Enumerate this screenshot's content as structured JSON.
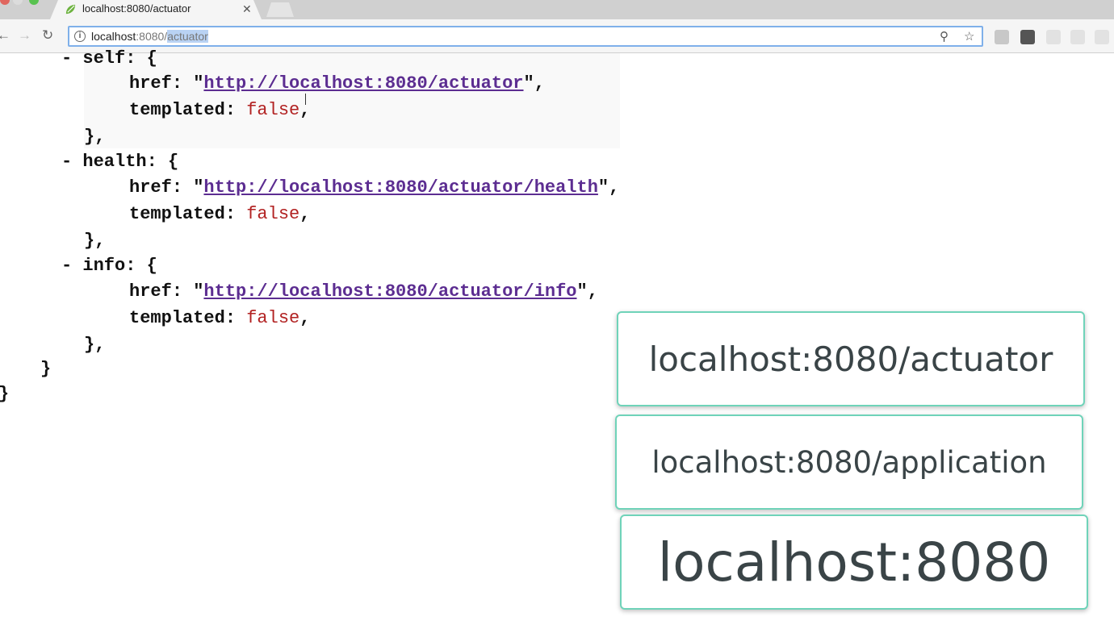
{
  "browser": {
    "tab_title": "localhost:8080/actuator",
    "tab_close": "✕",
    "nav_back": "←",
    "nav_forward": "→",
    "nav_reload": "↻",
    "info_glyph": "i",
    "url_host": "localhost",
    "url_port": ":8080/",
    "url_path": "actuator",
    "zoom_glyph": "⚲",
    "star_glyph": "☆"
  },
  "json": {
    "links": [
      {
        "key": "self",
        "href": "http://localhost:8080/actuator",
        "templated": "false"
      },
      {
        "key": "health",
        "href": "http://localhost:8080/actuator/health",
        "templated": "false"
      },
      {
        "key": "info",
        "href": "http://localhost:8080/actuator/info",
        "templated": "false"
      }
    ],
    "href_key": "href",
    "templated_key": "templated",
    "collapse_glyph": "-"
  },
  "overlay": {
    "cards": [
      "localhost:8080/actuator",
      "localhost:8080/application",
      "localhost:8080"
    ]
  },
  "colors": {
    "card_border": "#6fd3b9",
    "link": "#5c2d91",
    "boolean": "#b22222",
    "omnibox_border": "#7fb0ea"
  }
}
